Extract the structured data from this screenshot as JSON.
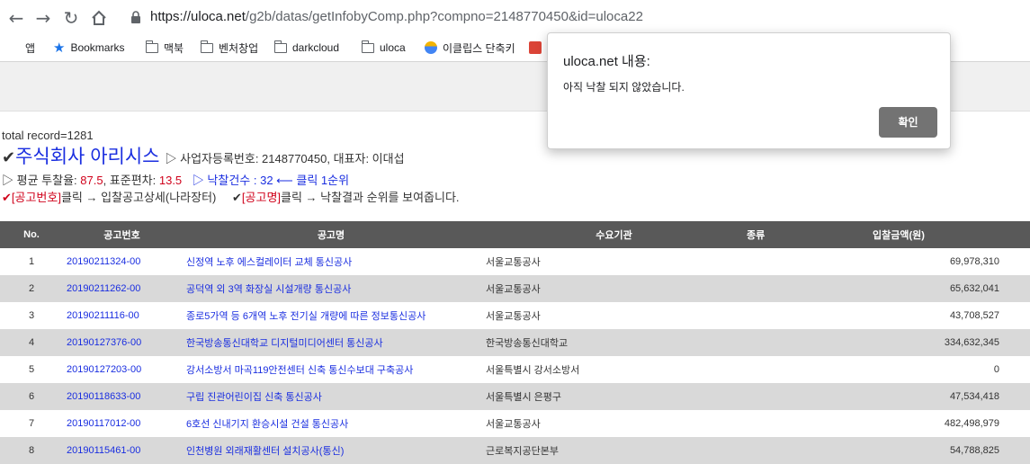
{
  "browser": {
    "url_host": "https://uloca.net",
    "url_path": "/g2b/datas/getInfobyComp.php?compno=2148770450&id=uloca22"
  },
  "bookmarks": [
    {
      "label": "앱",
      "icon": "apps-grid-icon"
    },
    {
      "label": "Bookmarks",
      "icon": "star-icon"
    },
    {
      "label": "맥북",
      "icon": "folder-icon"
    },
    {
      "label": "벤처창업",
      "icon": "folder-icon"
    },
    {
      "label": "darkcloud",
      "icon": "folder-icon"
    },
    {
      "label": "uloca",
      "icon": "folder-icon"
    },
    {
      "label": "이클립스 단축키",
      "icon": "site-favicon-icon"
    }
  ],
  "page": {
    "total": "total record=1281",
    "company_name": "주식회사 아리시스",
    "company_meta": "▷ 사업자등록번호: 2148770450, 대표자: 이대섭",
    "avg_label": "▷ 평균 투찰율: ",
    "avg_value": "87.5",
    "std_label": ", 표준편차: ",
    "std_value": "13.5",
    "win_link": "▷ 낙찰건수 : 32 ⟵ 클릭 1순위",
    "help_a_mark": "✔[공고번호]",
    "help_a_text": "클릭 → 입찰공고상세(나라장터)",
    "help_b_mark": "[공고명]",
    "help_b_text": "클릭 → 낙찰결과 순위를 보여줍니다."
  },
  "table": {
    "headers": [
      "No.",
      "공고번호",
      "공고명",
      "수요기관",
      "종류",
      "입찰금액(원)"
    ],
    "rows": [
      {
        "no": "1",
        "code": "20190211324-00",
        "title": "신정역 노후 에스컬레이터 교체 통신공사",
        "org": "서울교통공사",
        "kind": "",
        "amount": "69,978,310"
      },
      {
        "no": "2",
        "code": "20190211262-00",
        "title": "공덕역 외 3역 화장실 시설개량 통신공사",
        "org": "서울교통공사",
        "kind": "",
        "amount": "65,632,041"
      },
      {
        "no": "3",
        "code": "20190211116-00",
        "title": "종로5가역 등 6개역 노후 전기실 개량에 따른 정보통신공사",
        "org": "서울교통공사",
        "kind": "",
        "amount": "43,708,527"
      },
      {
        "no": "4",
        "code": "20190127376-00",
        "title": "한국방송통신대학교 디지털미디어센터 통신공사",
        "org": "한국방송통신대학교",
        "kind": "",
        "amount": "334,632,345"
      },
      {
        "no": "5",
        "code": "20190127203-00",
        "title": "강서소방서 마곡119안전센터 신축 통신수보대 구축공사",
        "org": "서울특별시 강서소방서",
        "kind": "",
        "amount": "0"
      },
      {
        "no": "6",
        "code": "20190118633-00",
        "title": "구립 진관어린이집 신축 통신공사",
        "org": "서울특별시 은평구",
        "kind": "",
        "amount": "47,534,418"
      },
      {
        "no": "7",
        "code": "20190117012-00",
        "title": "6호선 신내기지 환승시설 건설 통신공사",
        "org": "서울교통공사",
        "kind": "",
        "amount": "482,498,979"
      },
      {
        "no": "8",
        "code": "20190115461-00",
        "title": "인천병원 외래재활센터 설치공사(통신)",
        "org": "근로복지공단본부",
        "kind": "",
        "amount": "54,788,825"
      }
    ]
  },
  "dialog": {
    "title": "uloca.net 내용:",
    "message": "아직 낙찰 되지 않았습니다.",
    "ok_label": "확인"
  }
}
